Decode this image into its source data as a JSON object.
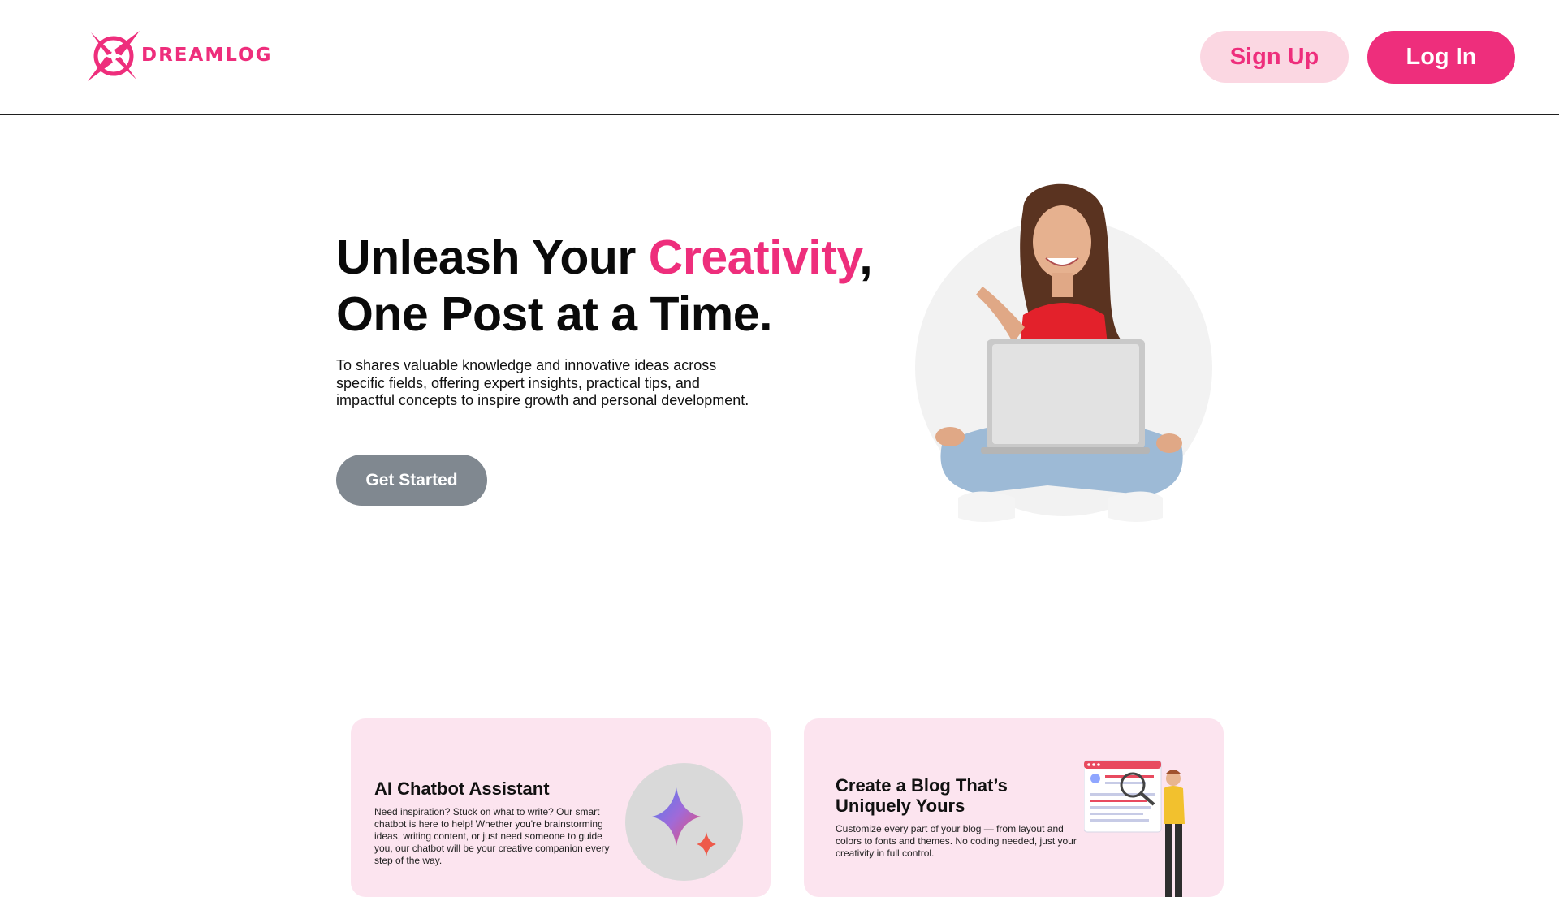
{
  "header": {
    "logo_text": "DREAMLOG",
    "signup_label": "Sign Up",
    "login_label": "Log In"
  },
  "hero": {
    "title_part1": "Unleash Your ",
    "title_accent": "Creativity",
    "title_part2": ",",
    "title_line2": "One Post at a Time.",
    "description": "To shares valuable knowledge and innovative ideas across specific fields, offering expert insights, practical tips, and impactful concepts to inspire growth and personal development.",
    "cta_label": "Get Started"
  },
  "features": [
    {
      "title": "AI Chatbot Assistant",
      "text": "Need inspiration? Stuck on what to write? Our smart chatbot is here to help! Whether you're brainstorming ideas, writing content, or just need someone to guide you, our chatbot will be your creative companion every step of the way.",
      "icon": "sparkle-icon"
    },
    {
      "title": "Create a Blog That’s Uniquely Yours",
      "text": "Customize every part of your blog — from layout and colors to fonts and themes. No coding needed, just your creativity in full control.",
      "icon": "blog-customize-illustration"
    }
  ],
  "colors": {
    "brand": "#ee2e7c",
    "brand_light": "#fbd7e2",
    "card_bg": "#fce4ef",
    "cta_gray": "#808890"
  }
}
